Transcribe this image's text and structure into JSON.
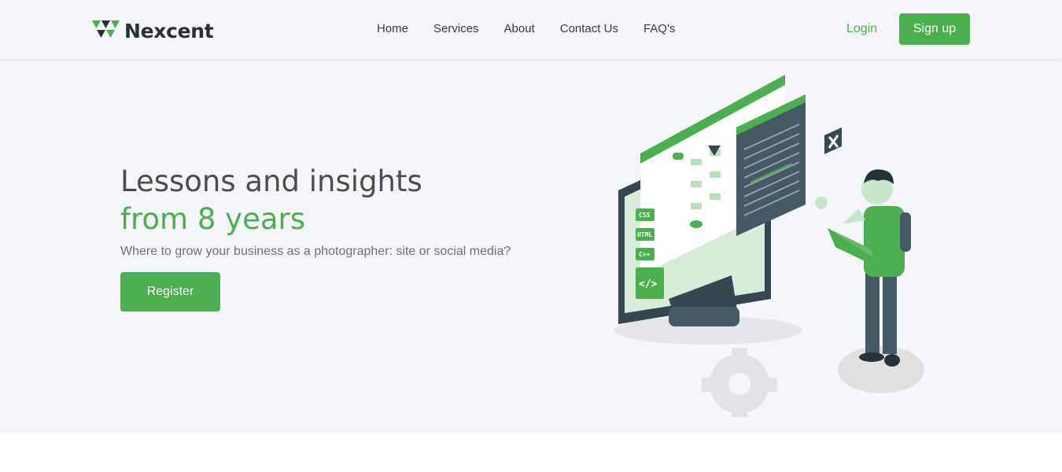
{
  "brand": {
    "name": "Nexcent"
  },
  "nav": {
    "links": [
      "Home",
      "Services",
      "About",
      "Contact Us",
      "FAQ's"
    ],
    "login_label": "Login",
    "signup_label": "Sign up"
  },
  "hero": {
    "headline_line1": "Lessons and insights",
    "headline_line2": "from 8 years",
    "subtitle": "Where to grow your business as a photographer: site or social media?",
    "cta_label": "Register"
  },
  "illustration": {
    "badges": [
      "CSS",
      "HTML",
      "C++"
    ],
    "code_tag": "</>"
  },
  "colors": {
    "accent": "#4caf4f",
    "dark": "#263238",
    "background": "#f5f6f9"
  }
}
